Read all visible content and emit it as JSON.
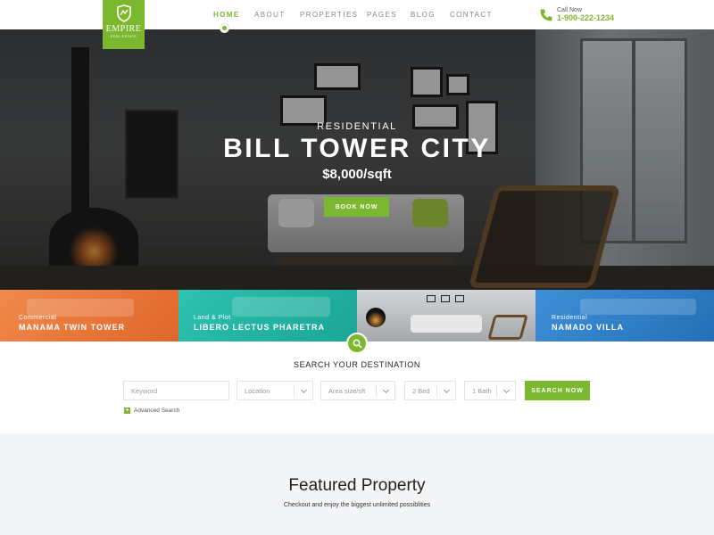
{
  "brand": {
    "name": "EMPIRE",
    "tagline": "REAL ESTATE",
    "accent": "#7cb82f"
  },
  "nav": {
    "items": [
      {
        "label": "HOME",
        "active": true
      },
      {
        "label": "ABOUT",
        "active": false
      },
      {
        "label": "PROPERTIES",
        "active": false
      },
      {
        "label": "PAGES",
        "active": false
      },
      {
        "label": "BLOG",
        "active": false
      },
      {
        "label": "CONTACT",
        "active": false
      }
    ]
  },
  "contact": {
    "label": "Call Now",
    "number": "1-900-222-1234",
    "icon": "phone-icon"
  },
  "hero": {
    "kicker": "RESIDENTIAL",
    "title": "BILL TOWER CITY",
    "price": "$8,000/sqft",
    "cta": "BOOK NOW"
  },
  "categories": [
    {
      "tag": "Commercial",
      "name": "MANAMA TWIN TOWER",
      "color": "#e8763a"
    },
    {
      "tag": "Land & Plot",
      "name": "LIBERO LECTUS PHARETRA",
      "color": "#22b3a3"
    },
    {
      "tag": "",
      "name": "",
      "color": "#bfc3c5"
    },
    {
      "tag": "Residential",
      "name": "NAMADO VILLA",
      "color": "#2f7fc8"
    }
  ],
  "search": {
    "title": "SEARCH YOUR DESTINATION",
    "keyword_placeholder": "Keyword",
    "location": "Location",
    "area": "Area size/sft",
    "beds": "2 Bed",
    "baths": "1 Bath",
    "submit": "SEARCH NOW",
    "advanced": "Advanced Search"
  },
  "featured": {
    "title": "Featured Property",
    "subtitle": "Checkout and enjoy the biggest unlimited possiblities"
  }
}
